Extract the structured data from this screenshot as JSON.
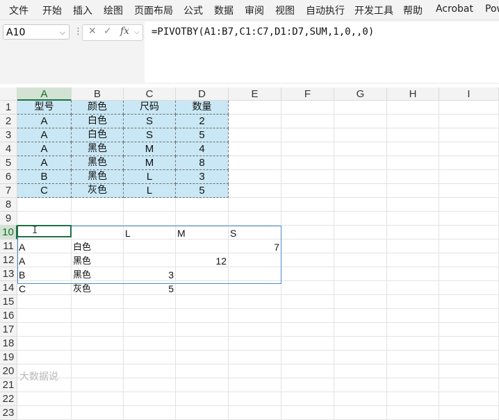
{
  "ribbon": {
    "tabs": [
      "文件",
      "开始",
      "插入",
      "绘图",
      "页面布局",
      "公式",
      "数据",
      "审阅",
      "视图",
      "自动执行",
      "开发工具",
      "帮助",
      "Acrobat",
      "Pow"
    ]
  },
  "formula_bar": {
    "name_box": "A10",
    "formula": "=PIVOTBY(A1:B7,C1:C7,D1:D7,SUM,1,0,,0)"
  },
  "columns": [
    "A",
    "B",
    "C",
    "D",
    "E",
    "F",
    "G",
    "H",
    "I"
  ],
  "rows": [
    "1",
    "2",
    "3",
    "4",
    "5",
    "6",
    "7",
    "8",
    "9",
    "10",
    "11",
    "12",
    "13",
    "14",
    "15",
    "16",
    "17",
    "18",
    "19",
    "20",
    "21",
    "22",
    "23"
  ],
  "source_table": {
    "header": [
      "型号",
      "颜色",
      "尺码",
      "数量"
    ],
    "rows": [
      [
        "A",
        "白色",
        "S",
        "2"
      ],
      [
        "A",
        "白色",
        "S",
        "5"
      ],
      [
        "A",
        "黑色",
        "M",
        "4"
      ],
      [
        "A",
        "黑色",
        "M",
        "8"
      ],
      [
        "B",
        "黑色",
        "L",
        "3"
      ],
      [
        "C",
        "灰色",
        "L",
        "5"
      ]
    ]
  },
  "pivot": {
    "header": [
      "",
      "",
      "L",
      "M",
      "S"
    ],
    "rows": [
      [
        "A",
        "白色",
        "",
        "",
        "7"
      ],
      [
        "A",
        "黑色",
        "",
        "12",
        ""
      ],
      [
        "B",
        "黑色",
        "3",
        "",
        ""
      ],
      [
        "C",
        "灰色",
        "5",
        "",
        ""
      ]
    ]
  },
  "watermark": "大数据说"
}
